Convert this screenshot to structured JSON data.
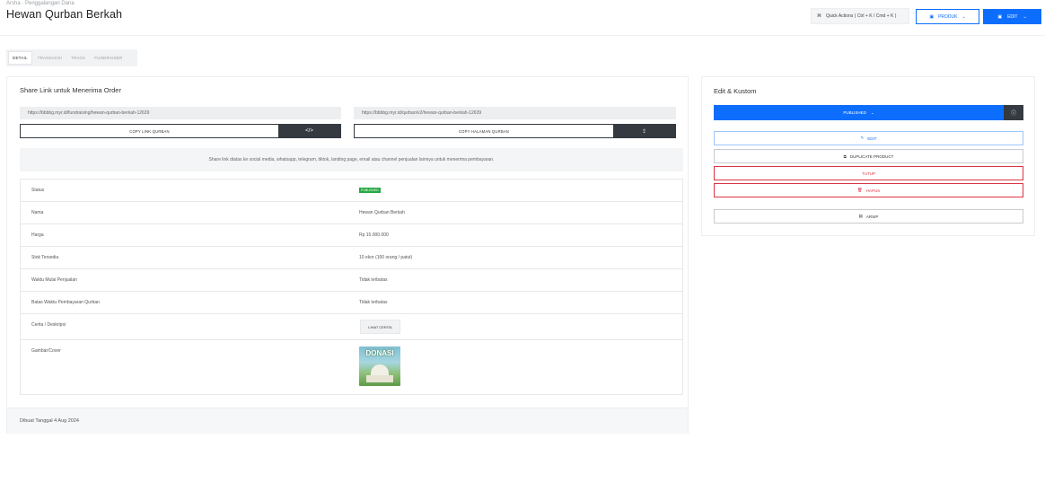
{
  "header": {
    "breadcrumb": "Arsha · Penggalangan Dana",
    "title": "Hewan Qurban Berkah",
    "quick_actions_label": "Quick Actions ( Ctrl + K / Cmd + K )",
    "produk_label": "PRODUK",
    "edit_label": "EDIT"
  },
  "tabs": [
    {
      "label": "DETAIL"
    },
    {
      "label": "TRANSAKSI"
    },
    {
      "label": "TRACK"
    },
    {
      "label": "FUNDRAISER"
    }
  ],
  "share": {
    "title": "Share Link untuk Menerima Order",
    "link_fundraising": "https://bbbbg.myr.id/fundraising/hewan-qurban-berkah-12639",
    "link_qurban": "https://bbbbg.myr.id/qurban/v2/hewan-qurban-berkah-12639",
    "copy_link_label": "COPY LINK QURBAN",
    "copy_page_label": "COPY HALAMAN QURBAN",
    "code_icon": "</>",
    "share_icon": "⇪",
    "info_text": "Share link diatas ke social media, whatsapp, telegram, tiktok, landing page, email atau channel penjualan lainnya untuk menerima pembayaran."
  },
  "details": [
    {
      "label": "Status",
      "value": "PUBLISHED"
    },
    {
      "label": "Nama",
      "value": "Hewan Qurban Berkah"
    },
    {
      "label": "Harga",
      "value": "Rp 15.000.000"
    },
    {
      "label": "Stok Tersedia",
      "value": "10 ekor (100 orang / patut)"
    },
    {
      "label": "Waktu Mulai Penjualan",
      "value": "Tidak terbatas"
    },
    {
      "label": "Batas Waktu Pembayaran Qurban",
      "value": "Tidak terbatas"
    },
    {
      "label": "Cerita / Deskripsi",
      "value": "LIHAT CERITA"
    },
    {
      "label": "Gambar/Cover",
      "value": "DONASI"
    }
  ],
  "footer": {
    "created": "Dibuat Tanggal 4 Aug 2024"
  },
  "sidebar": {
    "title": "Edit & Kustom",
    "status_label": "PUBLISHED",
    "status_info_icon": "ⓘ",
    "buttons": [
      {
        "label": "EDIT",
        "icon": "✎"
      },
      {
        "label": "DUPLICATE PRODUCT",
        "icon": "⧉"
      },
      {
        "label": "TUTUP",
        "icon": ""
      },
      {
        "label": "HAPUS",
        "icon": "🗑"
      },
      {
        "label": "ARSIP",
        "icon": "▤"
      }
    ]
  },
  "colors": {
    "primary": "#0d6efd",
    "dark": "#343a40",
    "danger": "#dc3545",
    "success": "#28a745"
  }
}
